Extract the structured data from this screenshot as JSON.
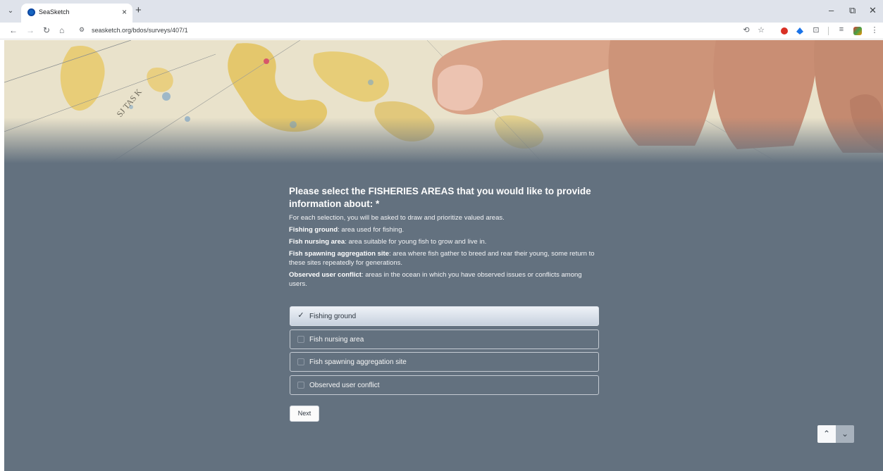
{
  "browser": {
    "tab_title": "SeaSketch",
    "url": "seasketch.org/bdos/surveys/407/1",
    "icons": [
      "tab-menu-icon",
      "favicon",
      "close-icon",
      "new-tab-icon",
      "minimize-icon",
      "restore-icon",
      "window-close-icon",
      "back-icon",
      "forward-icon",
      "reload-icon",
      "home-icon",
      "site-info-icon",
      "translate-icon",
      "bookmark-star-icon",
      "extension-stop-icon",
      "extension-blue-icon",
      "extensions-puzzle-icon",
      "reading-list-icon",
      "extension-color-icon",
      "more-menu-icon"
    ]
  },
  "survey": {
    "title": "Please select the FISHERIES AREAS that you would like to provide information about: *",
    "intro": "For each selection, you will be asked to draw and prioritize valued areas.",
    "definitions": [
      {
        "term": "Fishing ground",
        "text": ": area used for fishing."
      },
      {
        "term": "Fish nursing area",
        "text": ": area suitable for young fish to grow and live in."
      },
      {
        "term": "Fish spawning aggregation site",
        "text": ": area where fish gather to breed and rear their young, some return to these sites repeatedly for generations."
      },
      {
        "term": "Observed user conflict",
        "text": ": areas in the ocean in which you have observed issues or conflicts among users."
      }
    ],
    "options": [
      {
        "label": "Fishing ground",
        "selected": true
      },
      {
        "label": "Fish nursing area",
        "selected": false
      },
      {
        "label": "Fish spawning aggregation site",
        "selected": false
      },
      {
        "label": "Observed user conflict",
        "selected": false
      }
    ],
    "next_label": "Next"
  },
  "colors": {
    "page_background": "#63717f",
    "selected_option": "#d6dee9",
    "accent_line": "#d7b75a"
  }
}
